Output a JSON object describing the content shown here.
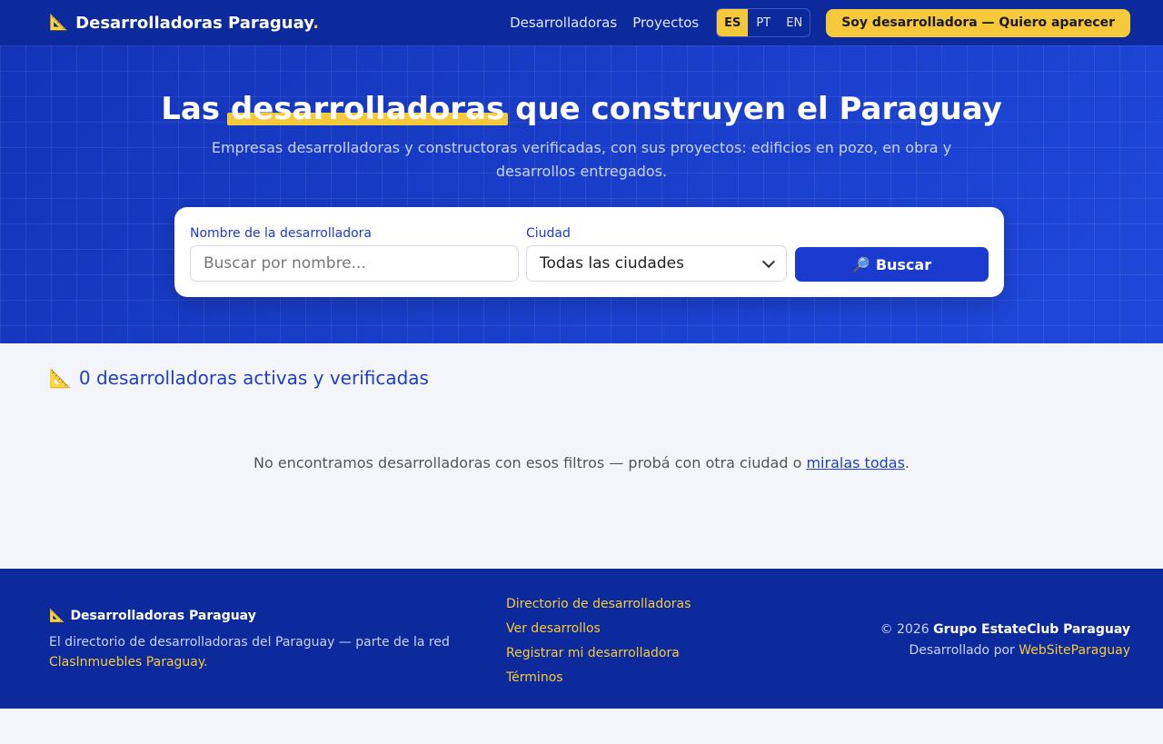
{
  "nav": {
    "brand_name": "Desarrolladoras Paraguay",
    "brand_dot": ".",
    "links": [
      "Desarrolladoras",
      "Proyectos"
    ],
    "languages": [
      "ES",
      "PT",
      "EN"
    ],
    "active_language": "ES",
    "cta": "Soy desarrolladora — Quiero aparecer"
  },
  "hero": {
    "title_pre": "Las",
    "title_highlight": "desarrolladoras",
    "title_post": "que construyen el Paraguay",
    "subtitle": "Empresas desarrolladoras y constructoras verificadas, con sus proyectos: edificios en pozo, en obra y desarrollos entregados."
  },
  "search": {
    "name_label": "Nombre de la desarrolladora",
    "name_placeholder": "Buscar por nombre...",
    "city_label": "Ciudad",
    "city_value": "Todas las ciudades",
    "button": "Buscar"
  },
  "results": {
    "title": "0 desarrolladoras activas y verificadas",
    "empty_text": "No encontramos desarrolladoras con esos filtros — probá con otra ciudad o",
    "empty_link": "miralas todas",
    "empty_end": "."
  },
  "footer": {
    "brand": "Desarrolladoras Paraguay",
    "desc": "El directorio de desarrolladoras del Paraguay — parte de la red",
    "desc_link": "ClasInmuebles Paraguay.",
    "links": [
      "Directorio de desarrolladoras",
      "Ver desarrollos",
      "Registrar mi desarrolladora",
      "Términos"
    ],
    "copyright_pre": "© 2026",
    "copyright_org": "Grupo EstateClub Paraguay",
    "dev_pre": "Desarrollado por",
    "dev_link": "WebSiteParaguay"
  },
  "colors": {
    "primary": "#1a3ad0",
    "nav": "#0d2a9c",
    "accent": "#f5c93a"
  }
}
